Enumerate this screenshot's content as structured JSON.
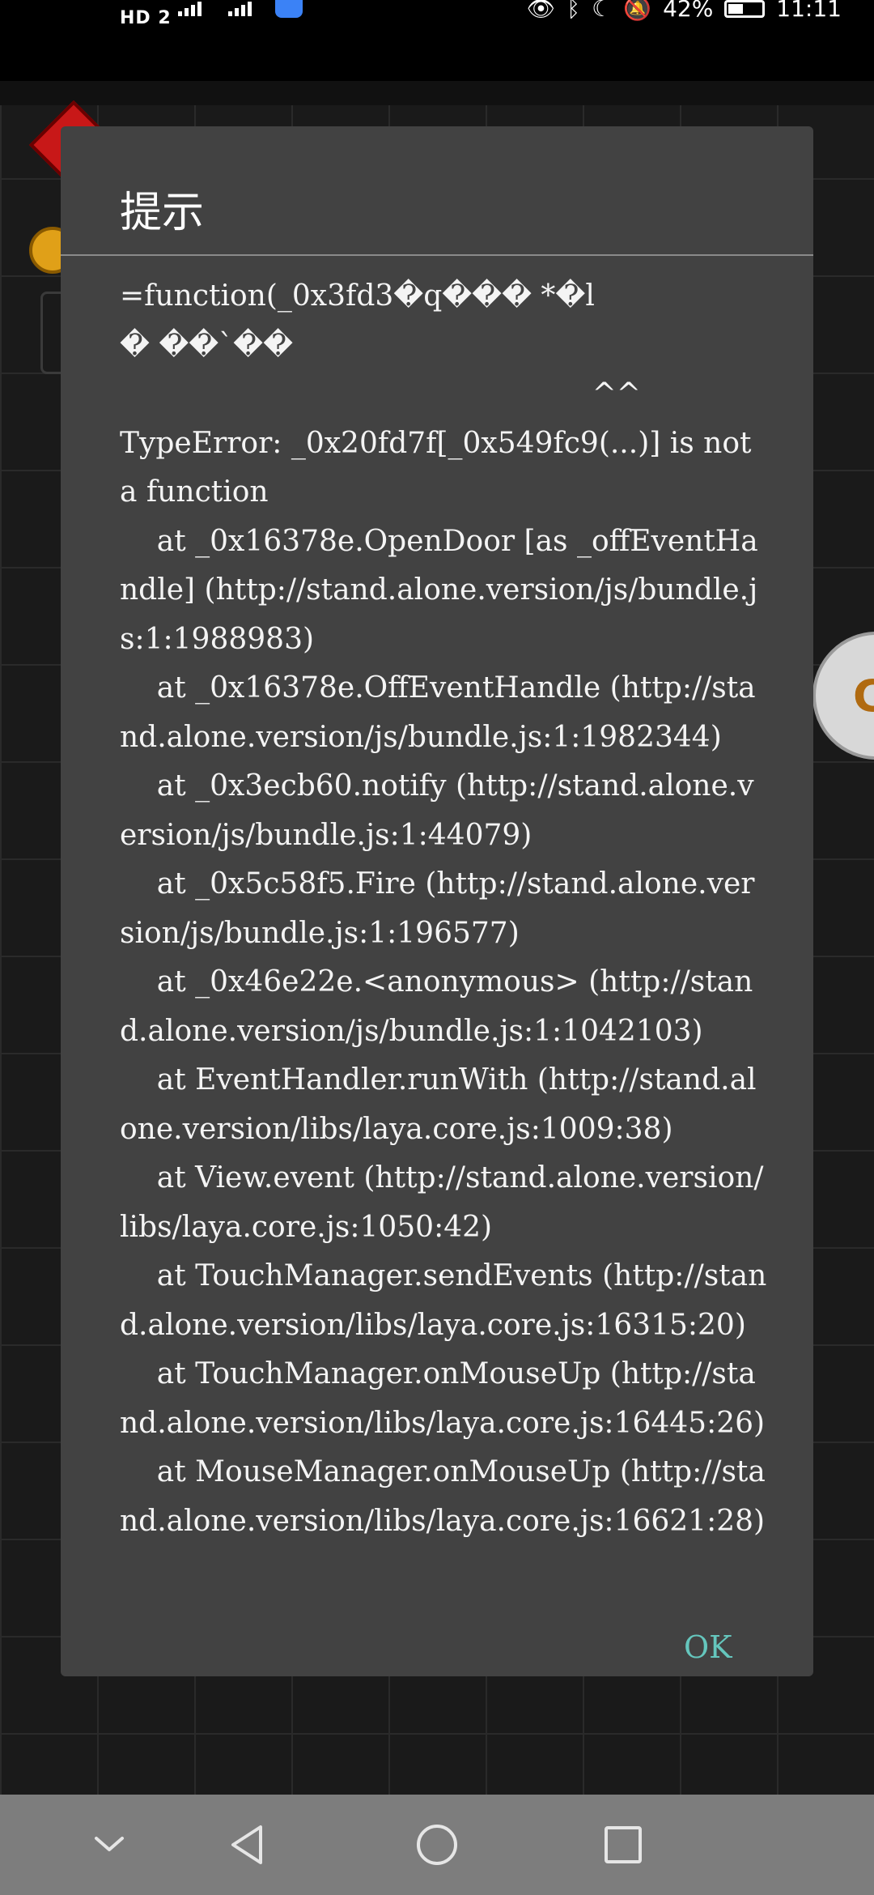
{
  "status_bar": {
    "hd_label": "HD 2",
    "battery_percent": "42%",
    "time": "11:11"
  },
  "dialog": {
    "title": "提示",
    "message": "=function(_0x3fd3�q��� *�l\n� ��`��\n                                                   ^^\nTypeError: _0x20fd7f[_0x549fc9(...)] is not a function\n    at _0x16378e.OpenDoor [as _offEventHandle] (http://stand.alone.version/js/bundle.js:1:1988983)\n    at _0x16378e.OffEventHandle (http://stand.alone.version/js/bundle.js:1:1982344)\n    at _0x3ecb60.notify (http://stand.alone.version/js/bundle.js:1:44079)\n    at _0x5c58f5.Fire (http://stand.alone.version/js/bundle.js:1:196577)\n    at _0x46e22e.<anonymous> (http://stand.alone.version/js/bundle.js:1:1042103)\n    at EventHandler.runWith (http://stand.alone.version/libs/laya.core.js:1009:38)\n    at View.event (http://stand.alone.version/libs/laya.core.js:1050:42)\n    at TouchManager.sendEvents (http://stand.alone.version/libs/laya.core.js:16315:20)\n    at TouchManager.onMouseUp (http://stand.alone.version/libs/laya.core.js:16445:26)\n    at MouseManager.onMouseUp (http://stand.alone.version/libs/laya.core.js:16621:28)",
    "ok_label": "OK"
  },
  "nav_bar": {
    "icons": [
      "chevron-down-icon",
      "back-triangle-icon",
      "home-circle-icon",
      "recents-square-icon"
    ]
  },
  "colors": {
    "dialog_background": "#424242",
    "ok_accent": "#65c6bd",
    "nav_background": "#7d7d7d"
  }
}
